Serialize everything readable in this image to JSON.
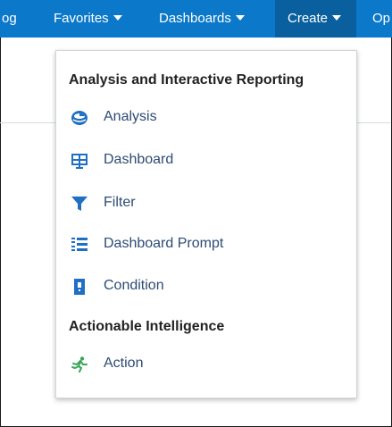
{
  "nav": {
    "catalog": "og",
    "favorites": "Favorites",
    "dashboards": "Dashboards",
    "create": "Create",
    "open": "Op"
  },
  "menu": {
    "sections": [
      {
        "heading": "Analysis and Interactive Reporting",
        "items": [
          {
            "label": "Analysis",
            "icon": "analysis-icon"
          },
          {
            "label": "Dashboard",
            "icon": "dashboard-icon"
          },
          {
            "label": "Filter",
            "icon": "filter-icon"
          },
          {
            "label": "Dashboard Prompt",
            "icon": "dashboard-prompt-icon"
          },
          {
            "label": "Condition",
            "icon": "condition-icon"
          }
        ]
      },
      {
        "heading": "Actionable Intelligence",
        "items": [
          {
            "label": "Action",
            "icon": "action-icon"
          }
        ]
      }
    ]
  },
  "colors": {
    "topbar": "#0b78c9",
    "active_tab": "#0a5f9f",
    "icon_blue": "#1f6fc4",
    "action_green": "#3aa55a",
    "link_text": "#2c4b74"
  }
}
